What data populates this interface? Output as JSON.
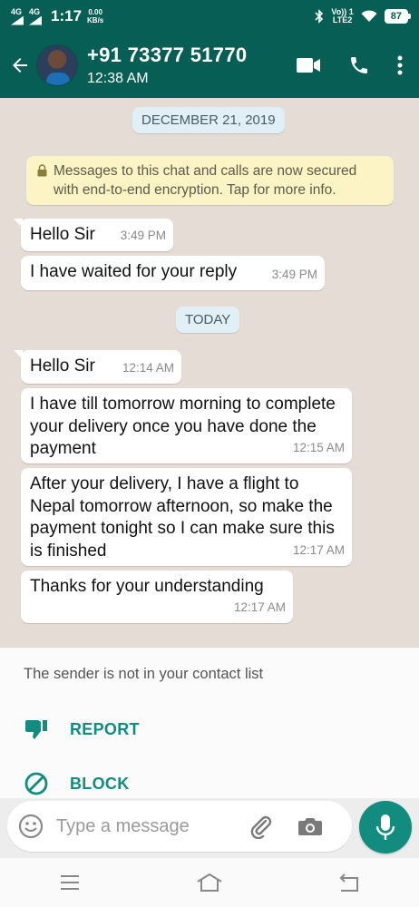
{
  "status_bar": {
    "network_left": "4G",
    "network_left2": "4G",
    "time": "1:17",
    "speed_value": "0.00",
    "speed_unit": "KB/s",
    "volte": "Vo)) 1",
    "lte": "LTE2",
    "battery": "87"
  },
  "header": {
    "contact_name": "+91 73377 51770",
    "subtitle": "12:38 AM"
  },
  "chat": {
    "date_chips": [
      "DECEMBER 21, 2019",
      "TODAY"
    ],
    "encryption_notice": "Messages to this chat and calls are now secured with end-to-end encryption. Tap for more info.",
    "messages": [
      {
        "text": "Hello Sir",
        "time": "3:49 PM"
      },
      {
        "text": "I have waited for your reply",
        "time": "3:49 PM"
      },
      {
        "text": "Hello Sir",
        "time": "12:14 AM"
      },
      {
        "text": "I have till tomorrow morning to complete your delivery once you have done the payment",
        "time": "12:15 AM"
      },
      {
        "text": "After your delivery, I have a flight to Nepal tomorrow afternoon, so make the payment tonight so I can make sure this is finished",
        "time": "12:17 AM"
      },
      {
        "text": "Thanks for your understanding",
        "time": "12:17 AM"
      }
    ]
  },
  "sheet": {
    "note": "The sender is not in your contact list",
    "report_label": "REPORT",
    "block_label": "BLOCK"
  },
  "composer": {
    "placeholder": "Type a message"
  },
  "colors": {
    "header": "#075e54",
    "accent": "#128c7e",
    "bubble": "#ffffff",
    "chat_bg": "#e5ddd5"
  },
  "icons": [
    "back-arrow-icon",
    "video-call-icon",
    "phone-icon",
    "more-vert-icon",
    "lock-icon",
    "thumbs-down-icon",
    "block-icon",
    "emoji-icon",
    "attach-icon",
    "camera-icon",
    "mic-icon",
    "menu-icon",
    "home-icon",
    "back-nav-icon"
  ]
}
